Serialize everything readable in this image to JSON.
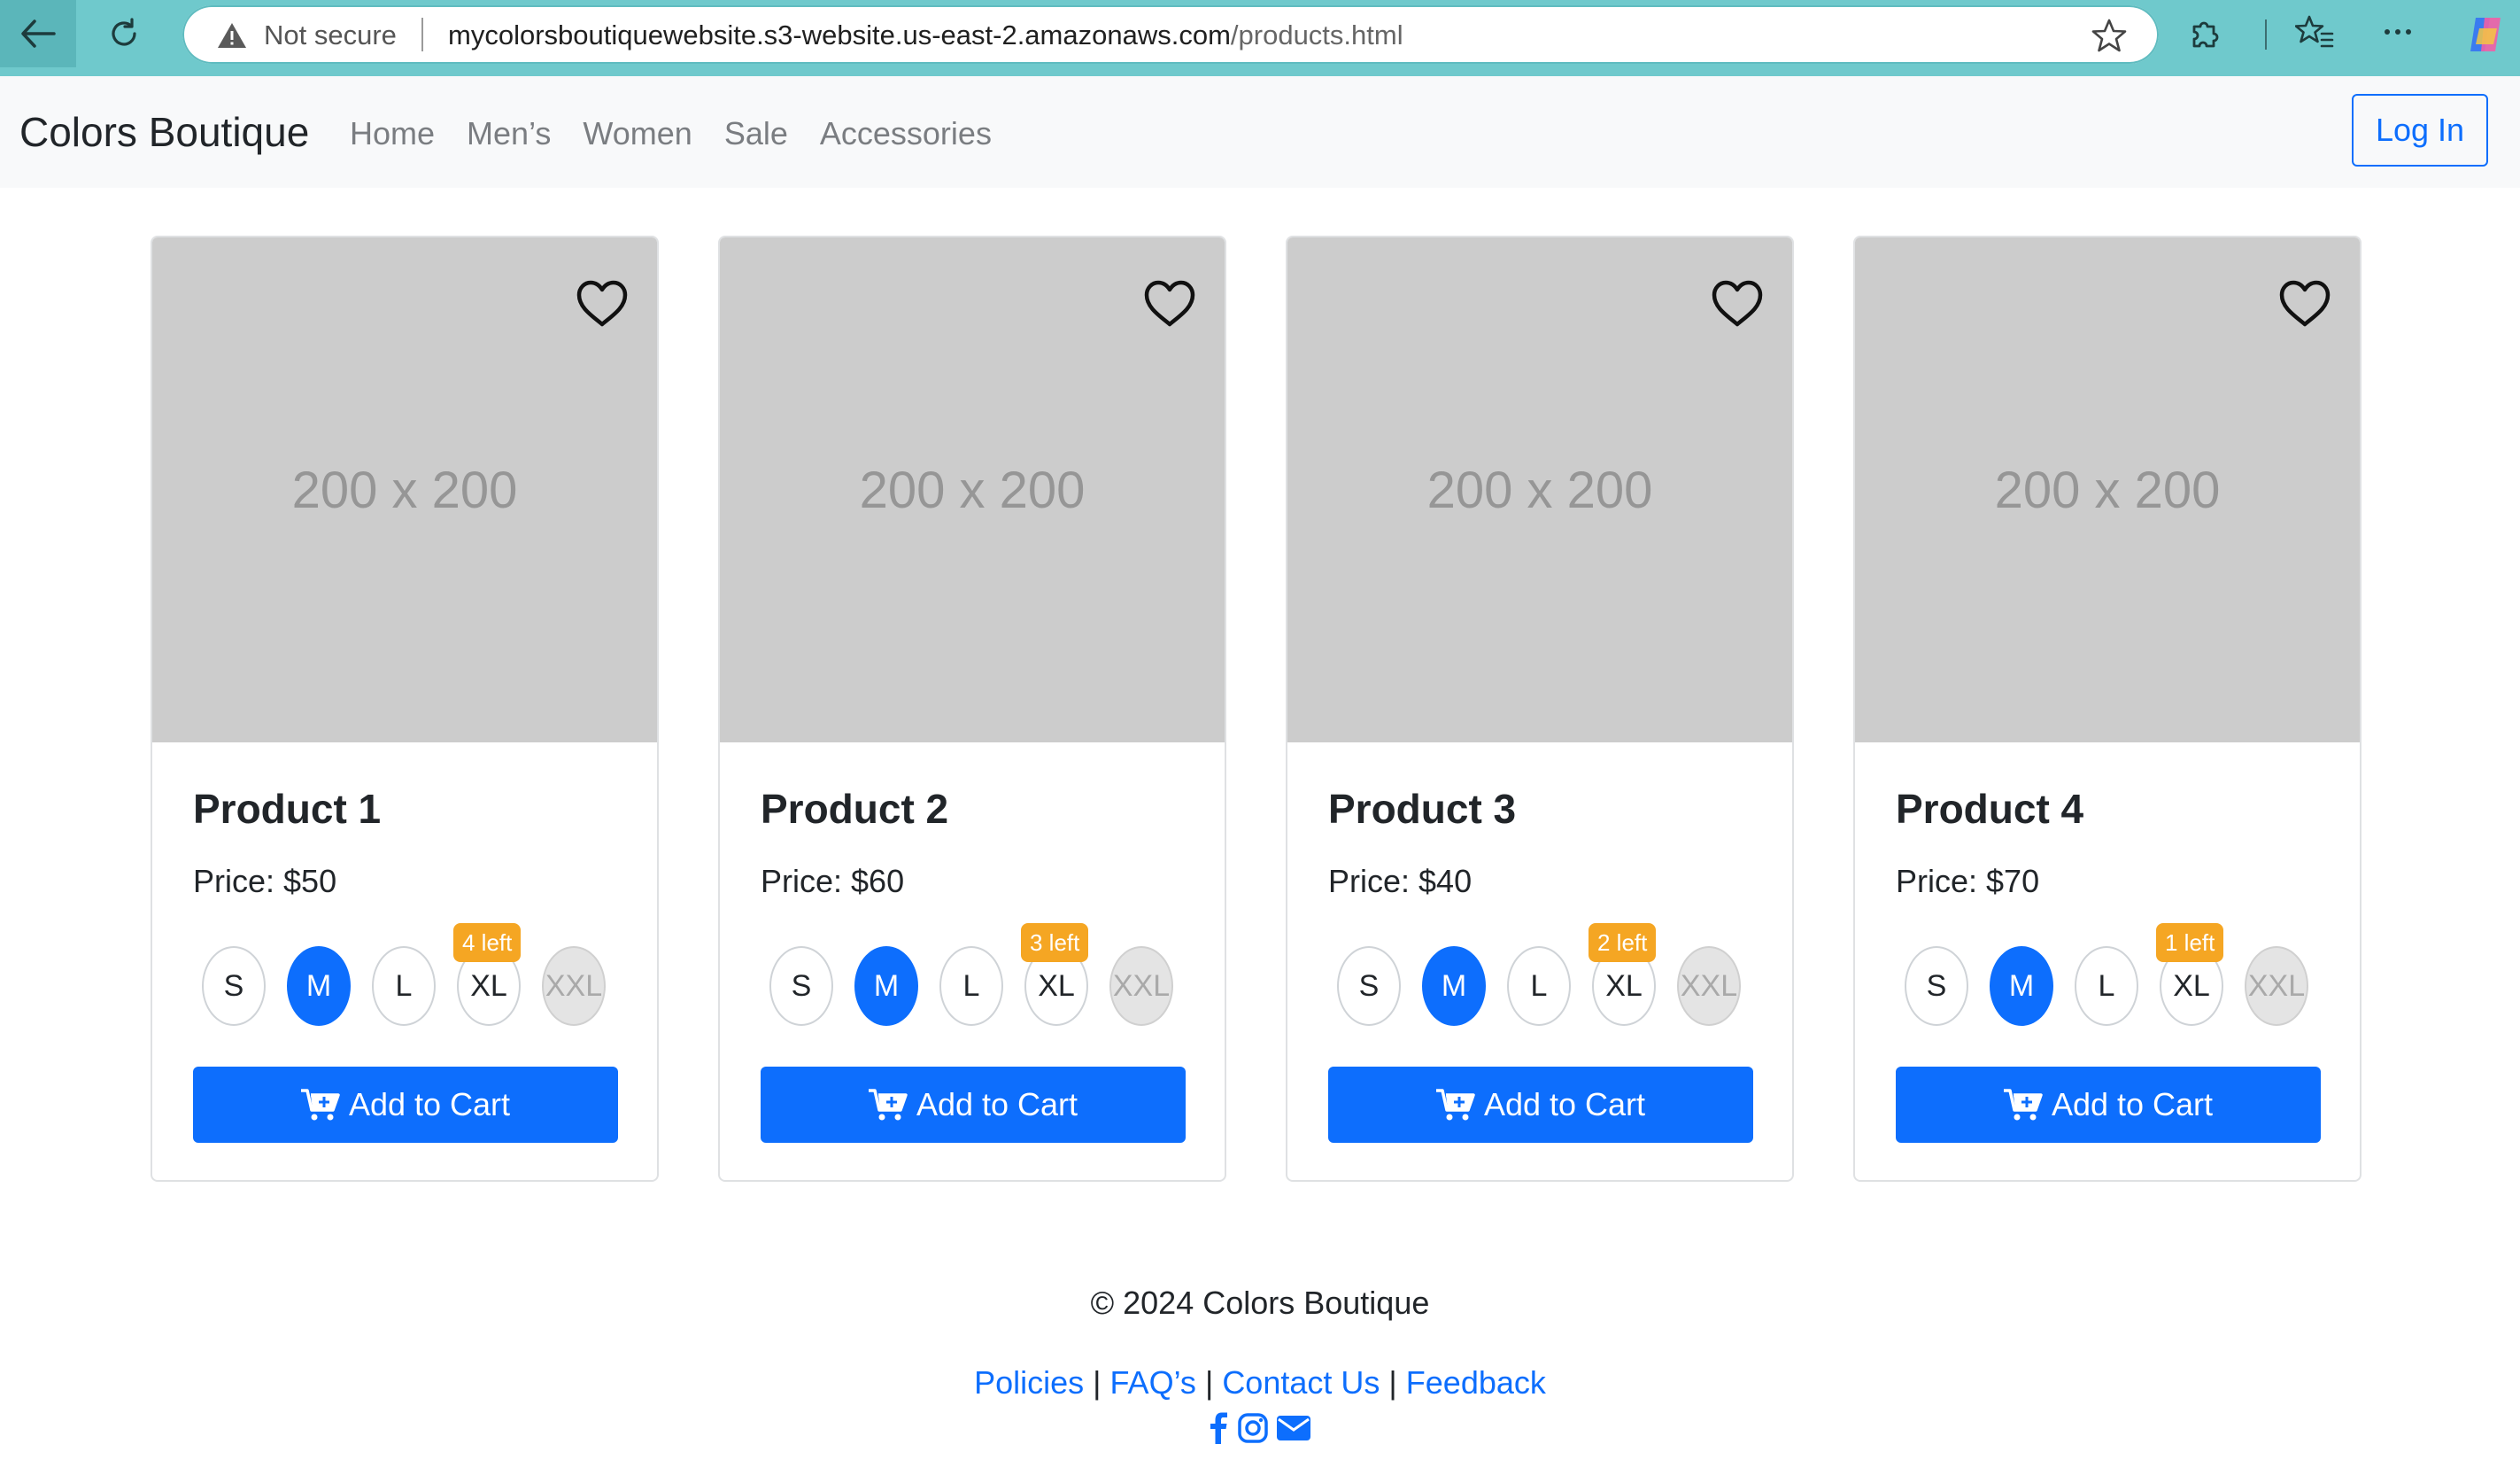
{
  "browser": {
    "security_label": "Not secure",
    "url_host": "mycolorsboutiquewebsite.s3-website.us-east-2.amazonaws.com",
    "url_path": "/products.html"
  },
  "navbar": {
    "brand": "Colors Boutique",
    "links": [
      "Home",
      "Men’s",
      "Women",
      "Sale",
      "Accessories"
    ],
    "login_label": "Log In"
  },
  "products": [
    {
      "image_text": "200 x 200",
      "title": "Product 1",
      "price": "Price: $50",
      "badge": "4 left"
    },
    {
      "image_text": "200 x 200",
      "title": "Product 2",
      "price": "Price: $60",
      "badge": "3 left"
    },
    {
      "image_text": "200 x 200",
      "title": "Product 3",
      "price": "Price: $40",
      "badge": "2 left"
    },
    {
      "image_text": "200 x 200",
      "title": "Product 4",
      "price": "Price: $70",
      "badge": "1 left"
    }
  ],
  "sizes": [
    "S",
    "M",
    "L",
    "XL",
    "XXL"
  ],
  "selected_size": "M",
  "unavailable_size": "XXL",
  "cart_label": "Add to Cart",
  "footer": {
    "copyright": "© 2024 Colors Boutique",
    "links": [
      "Policies",
      "FAQ’s",
      "Contact Us",
      "Feedback"
    ],
    "separator": "|",
    "social_icons": [
      "facebook-icon",
      "instagram-icon",
      "envelope-icon"
    ]
  },
  "colors": {
    "primary": "#0d6efd",
    "badge": "#f5a623",
    "chrome": "#6fc9cc",
    "image_placeholder": "#cccccc"
  }
}
